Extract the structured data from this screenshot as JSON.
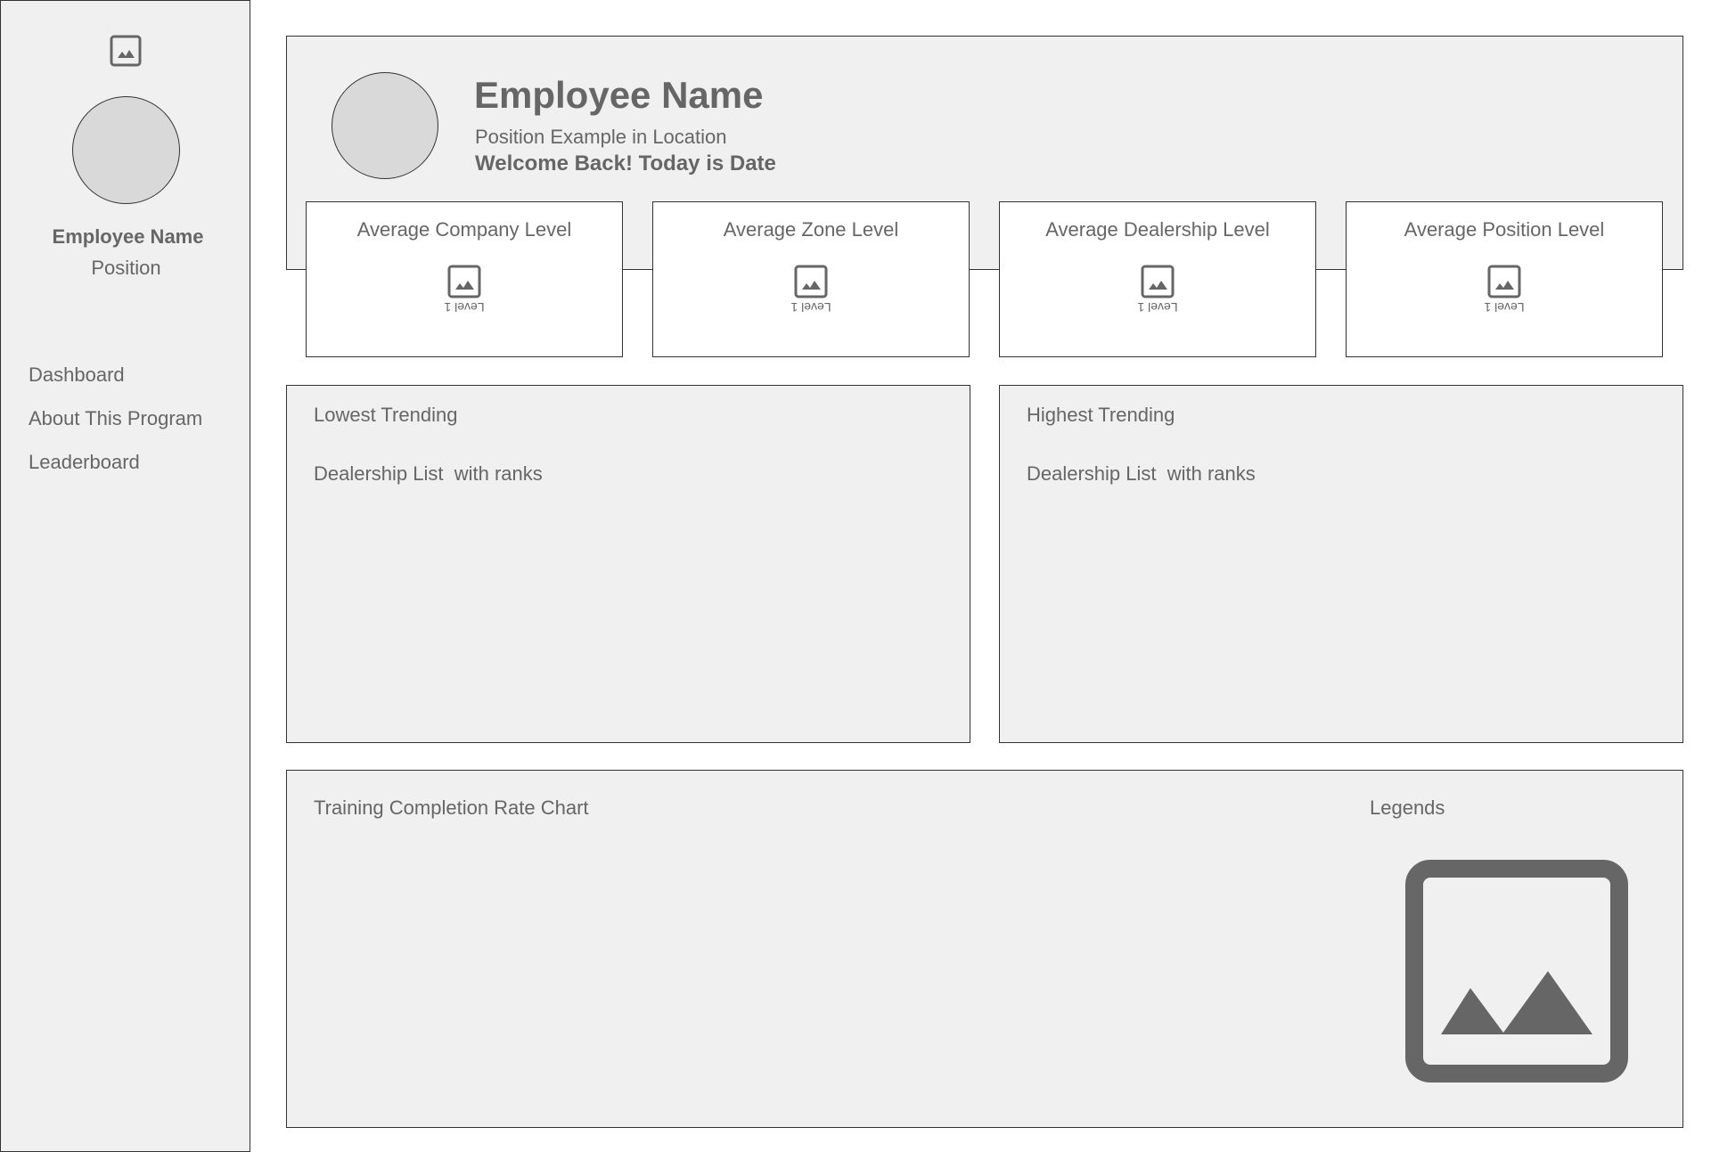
{
  "sidebar": {
    "logo_icon": "image-placeholder-icon",
    "employee_name": "Employee Name",
    "position": "Position",
    "nav": [
      {
        "label": "Dashboard"
      },
      {
        "label": "About This Program"
      },
      {
        "label": "Leaderboard"
      }
    ]
  },
  "header": {
    "employee_name": "Employee Name",
    "position_line": "Position Example in Location",
    "welcome_line": "Welcome Back! Today is Date"
  },
  "levels": [
    {
      "title": "Average Company Level",
      "value": "Level 1",
      "icon": "image-placeholder-icon"
    },
    {
      "title": "Average Zone Level",
      "value": "Level 1",
      "icon": "image-placeholder-icon"
    },
    {
      "title": "Average Dealership Level",
      "value": "Level 1",
      "icon": "image-placeholder-icon"
    },
    {
      "title": "Average Position Level",
      "value": "Level 1",
      "icon": "image-placeholder-icon"
    }
  ],
  "lowest": {
    "title": "Lowest Trending",
    "subtitle": "Dealership List  with ranks"
  },
  "highest": {
    "title": "Highest Trending",
    "subtitle": "Dealership List  with ranks"
  },
  "chart_panel": {
    "title": "Training Completion Rate Chart",
    "legends_label": "Legends",
    "legends_icon": "image-placeholder-icon"
  },
  "colors": {
    "panel_bg": "#f0f0f0",
    "avatar_fill": "#d9d9d9",
    "text": "#666666",
    "border": "#333333"
  }
}
